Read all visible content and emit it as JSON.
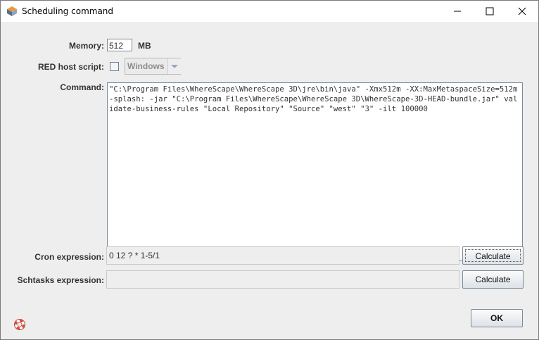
{
  "window": {
    "title": "Scheduling command"
  },
  "memory": {
    "label": "Memory:",
    "value": "512",
    "unit": "MB"
  },
  "red_host": {
    "label": "RED host script:",
    "checked": false,
    "combo_value": "Windows"
  },
  "command": {
    "label": "Command:",
    "text": "\"C:\\Program Files\\WhereScape\\WhereScape 3D\\jre\\bin\\java\" -Xmx512m -XX:MaxMetaspaceSize=512m -splash: -jar \"C:\\Program Files\\WhereScape\\WhereScape 3D\\WhereScape-3D-HEAD-bundle.jar\" validate-business-rules \"Local Repository\" \"Source\" \"west\" \"3\" -ilt 100000"
  },
  "cron": {
    "label": "Cron expression:",
    "value": "0 12 ? * 1-5/1",
    "button": "Calculate"
  },
  "schtasks": {
    "label": "Schtasks expression:",
    "value": "",
    "button": "Calculate"
  },
  "footer": {
    "ok_label": "OK"
  }
}
